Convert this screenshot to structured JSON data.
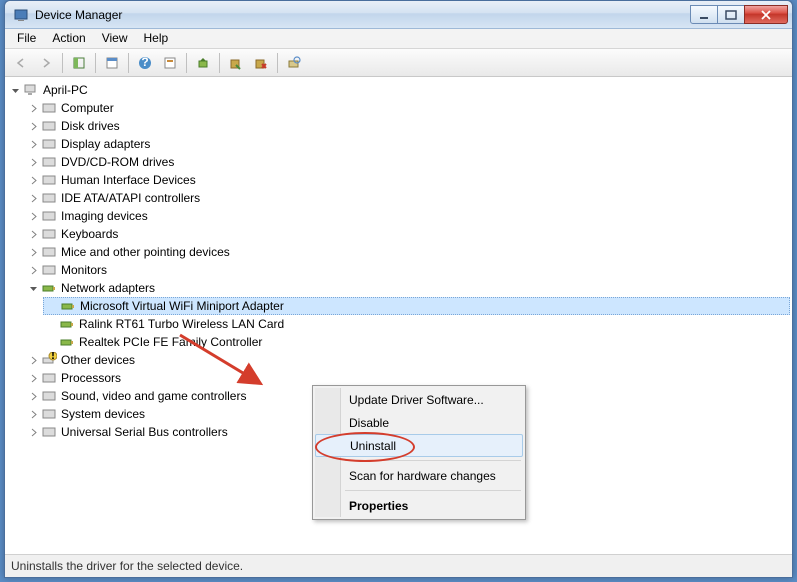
{
  "window": {
    "title": "Device Manager"
  },
  "menu": {
    "file": "File",
    "action": "Action",
    "view": "View",
    "help": "Help"
  },
  "tree": {
    "root": "April-PC",
    "nodes": [
      "Computer",
      "Disk drives",
      "Display adapters",
      "DVD/CD-ROM drives",
      "Human Interface Devices",
      "IDE ATA/ATAPI controllers",
      "Imaging devices",
      "Keyboards",
      "Mice and other pointing devices",
      "Monitors"
    ],
    "network": {
      "label": "Network adapters",
      "children": [
        "Microsoft Virtual WiFi Miniport Adapter",
        "Ralink RT61 Turbo Wireless LAN Card",
        "Realtek PCIe FE Family Controller"
      ]
    },
    "rest": [
      "Other devices",
      "Processors",
      "Sound, video and game controllers",
      "System devices",
      "Universal Serial Bus controllers"
    ]
  },
  "context": {
    "update": "Update Driver Software...",
    "disable": "Disable",
    "uninstall": "Uninstall",
    "scan": "Scan for hardware changes",
    "properties": "Properties"
  },
  "status": "Uninstalls the driver for the selected device."
}
